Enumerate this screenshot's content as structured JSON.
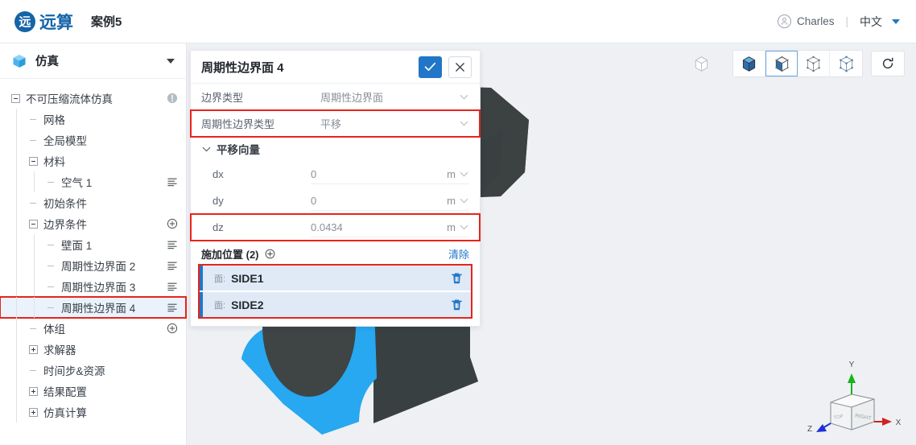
{
  "topbar": {
    "brand_mark": "远",
    "brand_name": "远算",
    "project_name": "案例5",
    "user_name": "Charles",
    "divider": "|",
    "language": "中文",
    "accent_color": "#2176c7",
    "brand_color": "#1464a8"
  },
  "sidebar": {
    "header": {
      "title": "仿真",
      "icon": "cube-icon"
    },
    "tree": [
      {
        "label": "不可压缩流体仿真",
        "depth": 0,
        "toggle": "minus",
        "right": "info",
        "selected": false,
        "boxed": false
      },
      {
        "label": "网格",
        "depth": 1,
        "toggle": "dash",
        "right": "none",
        "selected": false,
        "boxed": false
      },
      {
        "label": "全局模型",
        "depth": 1,
        "toggle": "dash",
        "right": "none",
        "selected": false,
        "boxed": false
      },
      {
        "label": "材料",
        "depth": 1,
        "toggle": "minus",
        "right": "none",
        "selected": false,
        "boxed": false
      },
      {
        "label": "空气 1",
        "depth": 2,
        "toggle": "dash",
        "right": "menu",
        "selected": false,
        "boxed": false
      },
      {
        "label": "初始条件",
        "depth": 1,
        "toggle": "dash",
        "right": "none",
        "selected": false,
        "boxed": false
      },
      {
        "label": "边界条件",
        "depth": 1,
        "toggle": "minus",
        "right": "plus",
        "selected": false,
        "boxed": false
      },
      {
        "label": "壁面 1",
        "depth": 2,
        "toggle": "dash",
        "right": "menu",
        "selected": false,
        "boxed": false
      },
      {
        "label": "周期性边界面 2",
        "depth": 2,
        "toggle": "dash",
        "right": "menu",
        "selected": false,
        "boxed": false
      },
      {
        "label": "周期性边界面 3",
        "depth": 2,
        "toggle": "dash",
        "right": "menu",
        "selected": false,
        "boxed": false
      },
      {
        "label": "周期性边界面 4",
        "depth": 2,
        "toggle": "dash",
        "right": "menu",
        "selected": true,
        "boxed": true
      },
      {
        "label": "体组",
        "depth": 1,
        "toggle": "dash",
        "right": "plus",
        "selected": false,
        "boxed": false
      },
      {
        "label": "求解器",
        "depth": 1,
        "toggle": "plus",
        "right": "none",
        "selected": false,
        "boxed": false
      },
      {
        "label": "时间步&资源",
        "depth": 1,
        "toggle": "dash",
        "right": "none",
        "selected": false,
        "boxed": false
      },
      {
        "label": "结果配置",
        "depth": 1,
        "toggle": "plus",
        "right": "none",
        "selected": false,
        "boxed": false
      },
      {
        "label": "仿真计算",
        "depth": 1,
        "toggle": "plus",
        "right": "none",
        "selected": false,
        "boxed": false
      }
    ]
  },
  "panel": {
    "title": "周期性边界面 4",
    "confirm_label": "✓",
    "cancel_label": "✕",
    "properties": [
      {
        "key": "边界类型",
        "value": "周期性边界面",
        "boxed": false
      },
      {
        "key": "周期性边界类型",
        "value": "平移",
        "boxed": true
      }
    ],
    "vector_section": {
      "label": "平移向量",
      "expanded": true
    },
    "vector": [
      {
        "key": "dx",
        "value": "0",
        "unit": "m",
        "boxed": false
      },
      {
        "key": "dy",
        "value": "0",
        "unit": "m",
        "boxed": false
      },
      {
        "key": "dz",
        "value": "0.0434",
        "unit": "m",
        "boxed": true
      }
    ],
    "location": {
      "title": "施加位置 (2)",
      "add_icon": "plus-circle-icon",
      "clear_label": "清除",
      "items": [
        {
          "kind": "面:",
          "name": "SIDE1"
        },
        {
          "kind": "面:",
          "name": "SIDE2"
        }
      ]
    }
  },
  "viewport": {
    "toolbar": [
      {
        "name": "cube-outline-icon",
        "active": false,
        "grouped": false
      },
      {
        "name": "cube-solid-icon",
        "active": false,
        "grouped": true
      },
      {
        "name": "cube-face-select-icon",
        "active": true,
        "grouped": true
      },
      {
        "name": "cube-vertex-gray-icon",
        "active": false,
        "grouped": true
      },
      {
        "name": "cube-vertex-blue-icon",
        "active": false,
        "grouped": true
      },
      {
        "name": "reset-view-icon",
        "active": false,
        "grouped": false
      }
    ],
    "axis_labels": {
      "x": "X",
      "y": "Y",
      "z": "Z",
      "cube_face": "RIGHT"
    },
    "model_colors": {
      "selected_face": "#27a8f0",
      "unselected_face": "#434849",
      "top_face": "#3b4041",
      "background": "#eef0f4"
    }
  },
  "annotation_color": "#e8241b"
}
